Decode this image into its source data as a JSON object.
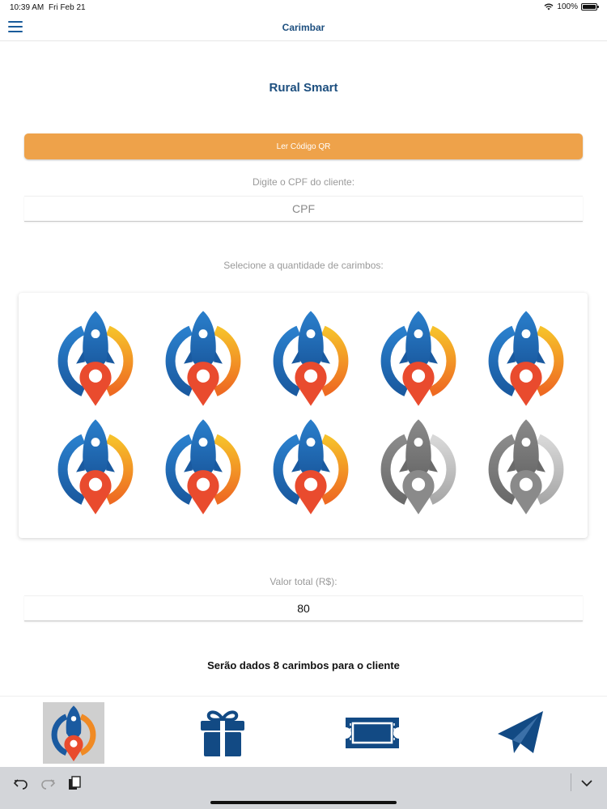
{
  "status_bar": {
    "time": "10:39 AM",
    "date": "Fri Feb 21",
    "battery": "100%"
  },
  "navbar": {
    "title": "Carimbar"
  },
  "app_title": "Rural Smart",
  "qr_button": {
    "label": "Ler Código QR"
  },
  "cpf": {
    "label": "Digite o CPF do cliente:",
    "placeholder": "CPF"
  },
  "stamps": {
    "label": "Selecione a quantidade de carimbos:",
    "total": 10,
    "selected": 8
  },
  "valor": {
    "label": "Valor total (R$):",
    "value": "80"
  },
  "summary": "Serão dados 8 carimbos para o cliente",
  "tabs": [
    {
      "name": "stamp",
      "icon": "rocket-pin-icon",
      "active": true
    },
    {
      "name": "gift",
      "icon": "gift-icon",
      "active": false
    },
    {
      "name": "ticket",
      "icon": "ticket-icon",
      "active": false
    },
    {
      "name": "send",
      "icon": "paper-plane-icon",
      "active": false
    }
  ],
  "colors": {
    "accent_orange": "#eea24a",
    "brand_blue": "#1d4f7f",
    "icon_blue": "#1a5b9a"
  }
}
